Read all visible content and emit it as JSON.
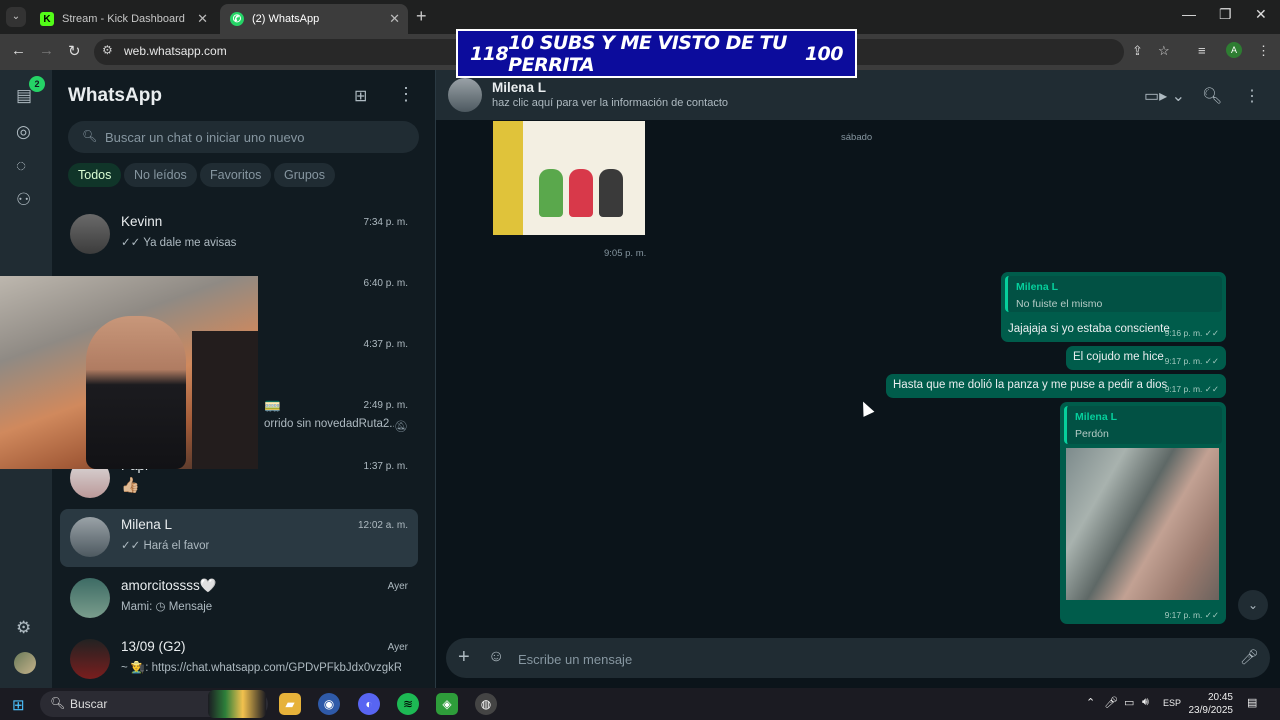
{
  "browser": {
    "tabs": [
      {
        "title": "Stream - Kick Dashboard",
        "favicon": "kick-icon",
        "color": "#53fc18"
      },
      {
        "title": "(2) WhatsApp",
        "favicon": "whatsapp-icon",
        "color": "#25d366"
      }
    ],
    "url": "web.whatsapp.com"
  },
  "overlay": {
    "left": "118",
    "center": "10 SUBS Y ME VISTO DE TU PERRITA",
    "right": "100"
  },
  "whatsapp": {
    "title": "WhatsApp",
    "unread_badge": "2",
    "search_placeholder": "Buscar un chat o iniciar uno nuevo",
    "filters": [
      "Todos",
      "No leídos",
      "Favoritos",
      "Grupos"
    ],
    "chats": [
      {
        "name": "Kevinn",
        "preview": "✓✓ Ya dale me avisas",
        "time": "7:34 p. m."
      },
      {
        "name": "",
        "preview": "",
        "time": "6:40 p. m."
      },
      {
        "name": "",
        "preview": "",
        "time": "4:37 p. m."
      },
      {
        "name": "🚃",
        "preview": "orrido sin novedadRuta2...",
        "time": "2:49 p. m."
      },
      {
        "name": "Papi",
        "preview": "👍🏼",
        "time": "1:37 p. m."
      },
      {
        "name": "Milena L",
        "preview": "✓✓ Hará el favor",
        "time": "12:02 a. m."
      },
      {
        "name": "amorcitossss🤍",
        "preview": "Mami: ◷ Mensaje",
        "time": "Ayer"
      },
      {
        "name": "13/09 (G2)",
        "preview": "~ 👨‍🌾: https://chat.whatsapp.com/GPDvPFkbJdx0vzgkRV...",
        "time": "Ayer"
      }
    ],
    "conversation": {
      "contact_name": "Milena L",
      "contact_sub": "haz clic aquí para ver la información de contacto",
      "day_separator": "sábado",
      "sticker_time": "9:05 p. m.",
      "messages": [
        {
          "quote_name": "Milena L",
          "quote_text": "No fuiste el mismo",
          "text": "Jajajaja si yo estaba consciente",
          "time": "9:16 p. m. ✓✓"
        },
        {
          "text": "El cojudo me hice",
          "time": "9:17 p. m. ✓✓"
        },
        {
          "text": "Hasta que me dolió la panza y me puse a pedir a dios",
          "time": "9:17 p. m. ✓✓"
        },
        {
          "quote_name": "Milena L",
          "quote_text": "Perdón",
          "time": "9:17 p. m. ✓✓"
        }
      ],
      "composer_placeholder": "Escribe un mensaje"
    }
  },
  "taskbar": {
    "search": "Buscar",
    "lang": "ESP",
    "time": "20:45",
    "date": "23/9/2025"
  }
}
